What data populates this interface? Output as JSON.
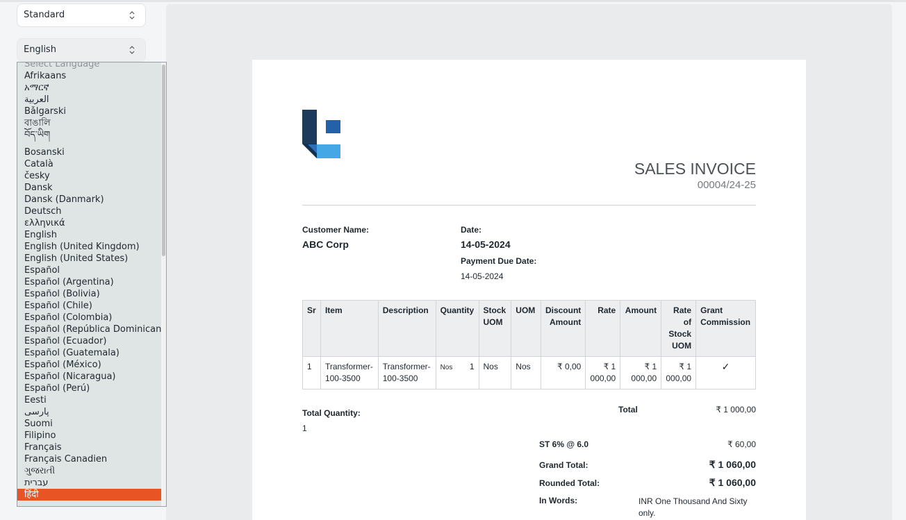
{
  "settings": {
    "format_value": "Standard",
    "language_value": "English"
  },
  "language_dropdown": {
    "placeholder": "Select Language",
    "selected": "हिंदी",
    "options": [
      "Afrikaans",
      "አማርኛ",
      "العربية",
      "Bǎlgarski",
      "বাঙালি",
      "བོད་ཡིག",
      "Bosanski",
      "Català",
      "česky",
      "Dansk",
      "Dansk (Danmark)",
      "Deutsch",
      "ελληνικά",
      "English",
      "English (United Kingdom)",
      "English (United States)",
      "Español",
      "Español (Argentina)",
      "Español (Bolivia)",
      "Español (Chile)",
      "Español (Colombia)",
      "Español (República Dominicana)",
      "Español (Ecuador)",
      "Español (Guatemala)",
      "Español (México)",
      "Español (Nicaragua)",
      "Español (Perú)",
      "Eesti",
      "پارسی",
      "Suomi",
      "Filipino",
      "Français",
      "Français Canadien",
      "ગુજરાતી",
      "עברית",
      "हिंदी"
    ]
  },
  "invoice": {
    "title": "SALES INVOICE",
    "number": "00004/24-25",
    "customer_label": "Customer Name:",
    "customer_value": "ABC Corp",
    "date_label": "Date:",
    "date_value": "14-05-2024",
    "due_label": "Payment Due Date:",
    "due_value": "14-05-2024",
    "columns": [
      "Sr",
      "Item",
      "Description",
      "Quantity",
      "Stock UOM",
      "UOM",
      "Discount Amount",
      "Rate",
      "Amount",
      "Rate of Stock UOM",
      "Grant Commission"
    ],
    "row": {
      "sr": "1",
      "item": "Transformer-100-3500",
      "description": "Transformer-100-3500",
      "qty_unit": "Nos",
      "qty": "1",
      "stock_uom": "Nos",
      "uom": "Nos",
      "discount": "₹ 0,00",
      "rate": "₹ 1 000,00",
      "amount": "₹ 1 000,00",
      "rate_stock": "₹ 1 000,00",
      "grant_commission": "✓"
    },
    "total_qty_label": "Total Quantity:",
    "total_qty_value": "1",
    "total_label": "Total",
    "total_value": "₹ 1 000,00",
    "tax_label": "ST 6% @ 6.0",
    "tax_value": "₹ 60,00",
    "grand_label": "Grand Total:",
    "grand_value": "₹ 1 060,00",
    "rounded_label": "Rounded Total:",
    "rounded_value": "₹ 1 060,00",
    "words_label": "In Words:",
    "words_value": "INR One Thousand And Sixty only."
  },
  "colors": {
    "selected": "#e95425",
    "logo_dark": "#1d3a5c",
    "logo_mid": "#2362a8",
    "logo_light": "#46a7e6"
  }
}
